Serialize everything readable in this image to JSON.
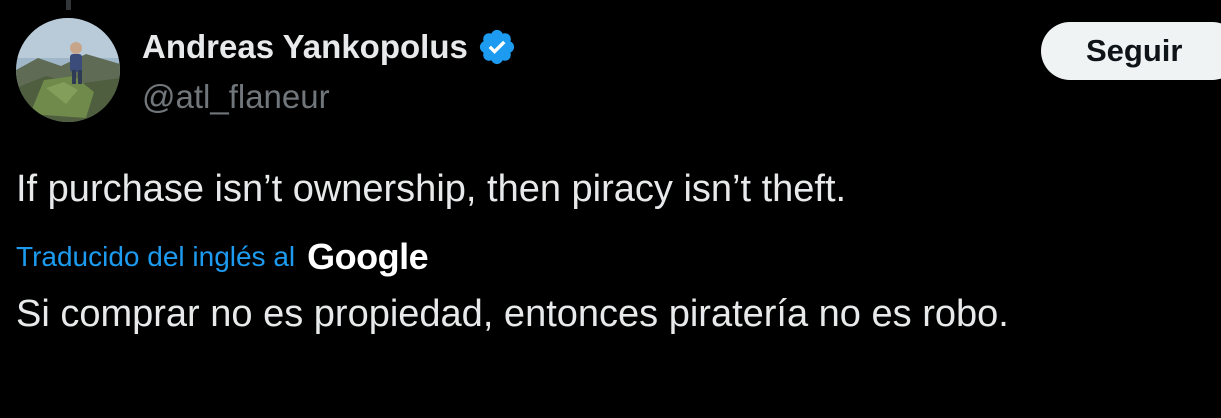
{
  "user": {
    "display_name": "Andreas Yankopolus",
    "handle": "@atl_flaneur",
    "verified": true,
    "verified_icon": "verified-badge-icon",
    "verified_color": "#1d9bf0"
  },
  "follow_button": {
    "label": "Seguir"
  },
  "tweet": {
    "text": "If purchase isn’t ownership, then piracy isn’t theft."
  },
  "translation": {
    "label": "Traducido del inglés al",
    "provider": "Google",
    "text": "Si comprar no es propiedad, entonces piratería no es robo."
  },
  "colors": {
    "background": "#000000",
    "primary_text": "#e7e9ea",
    "secondary_text": "#71767b",
    "link": "#1d9bf0",
    "button_bg": "#eff3f4"
  }
}
